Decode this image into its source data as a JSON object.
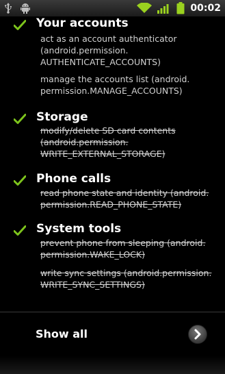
{
  "status_bar": {
    "time": "00:02",
    "icons": [
      "usb-icon",
      "android-debug-icon",
      "wifi-icon",
      "signal-icon",
      "battery-icon"
    ]
  },
  "sections": [
    {
      "title": "Your accounts",
      "permissions": [
        {
          "text": "act as an account authenticator (android.permission. AUTHENTICATE_ACCOUNTS)",
          "struck": false
        },
        {
          "text": "manage the accounts list (android. permission.MANAGE_ACCOUNTS)",
          "struck": false
        }
      ]
    },
    {
      "title": "Storage",
      "permissions": [
        {
          "text": "modify/delete SD card contents (android.permission. WRITE_EXTERNAL_STORAGE)",
          "struck": true
        }
      ]
    },
    {
      "title": "Phone calls",
      "permissions": [
        {
          "text": "read phone state and identity (android. permission.READ_PHONE_STATE)",
          "struck": true
        }
      ]
    },
    {
      "title": "System tools",
      "permissions": [
        {
          "text": "prevent phone from sleeping (android. permission.WAKE_LOCK)",
          "struck": true
        },
        {
          "text": "write sync settings (android.permission. WRITE_SYNC_SETTINGS)",
          "struck": true
        }
      ]
    }
  ],
  "show_all": {
    "label": "Show all"
  },
  "colors": {
    "check": "#7dc41c",
    "background": "#000000",
    "text_secondary": "#d2d2d2"
  }
}
